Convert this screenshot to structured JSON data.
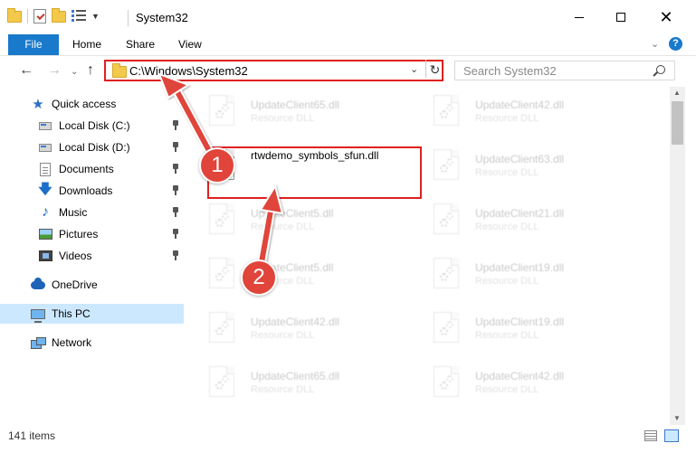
{
  "window": {
    "title": "System32",
    "controls": {
      "minimize": "minimize",
      "maximize": "maximize",
      "close": "✕"
    }
  },
  "ribbon": {
    "tabs": [
      {
        "label": "File",
        "active": true
      },
      {
        "label": "Home"
      },
      {
        "label": "Share"
      },
      {
        "label": "View"
      }
    ],
    "help": "?"
  },
  "address_bar": {
    "path": "C:\\Windows\\System32",
    "highlight_color": "#e02020"
  },
  "search": {
    "placeholder": "Search System32"
  },
  "sidebar": {
    "items": [
      {
        "label": "Quick access",
        "icon": "star-icon"
      },
      {
        "label": "Local Disk (C:)",
        "icon": "drive-icon",
        "pinned": true
      },
      {
        "label": "Local Disk (D:)",
        "icon": "drive-icon",
        "pinned": true
      },
      {
        "label": "Documents",
        "icon": "documents-icon",
        "pinned": true
      },
      {
        "label": "Downloads",
        "icon": "download-icon",
        "pinned": true
      },
      {
        "label": "Music",
        "icon": "music-icon",
        "pinned": true
      },
      {
        "label": "Pictures",
        "icon": "pictures-icon",
        "pinned": true
      },
      {
        "label": "Videos",
        "icon": "videos-icon",
        "pinned": true
      },
      {
        "label": "OneDrive",
        "icon": "cloud-icon"
      },
      {
        "label": "This PC",
        "icon": "pc-icon",
        "selected": true
      },
      {
        "label": "Network",
        "icon": "network-icon"
      }
    ]
  },
  "files": {
    "highlighted": {
      "name": "rtwdemo_symbols_sfun.dll"
    },
    "left_column": [
      {
        "name": "UpdateClient65.dll",
        "type": "Resource DLL"
      },
      {
        "name": "UpdateClient5.dll",
        "type": "Resource DLL"
      },
      {
        "name": "UpdateClient5.dll",
        "type": "Resource DLL"
      },
      {
        "name": "UpdateClient42.dll",
        "type": "Resource DLL"
      },
      {
        "name": "UpdateClient65.dll",
        "type": "Resource DLL"
      }
    ],
    "right_column": [
      {
        "name": "UpdateClient42.dll",
        "type": "Resource DLL"
      },
      {
        "name": "UpdateClient63.dll",
        "type": "Resource DLL"
      },
      {
        "name": "UpdateClient21.dll",
        "type": "Resource DLL"
      },
      {
        "name": "UpdateClient19.dll",
        "type": "Resource DLL"
      },
      {
        "name": "UpdateClient19.dll",
        "type": "Resource DLL"
      },
      {
        "name": "UpdateClient42.dll",
        "type": "Resource DLL"
      }
    ]
  },
  "status": {
    "item_count": "141 items"
  },
  "annotations": {
    "step1": "1",
    "step2": "2",
    "color": "#e0443a"
  }
}
